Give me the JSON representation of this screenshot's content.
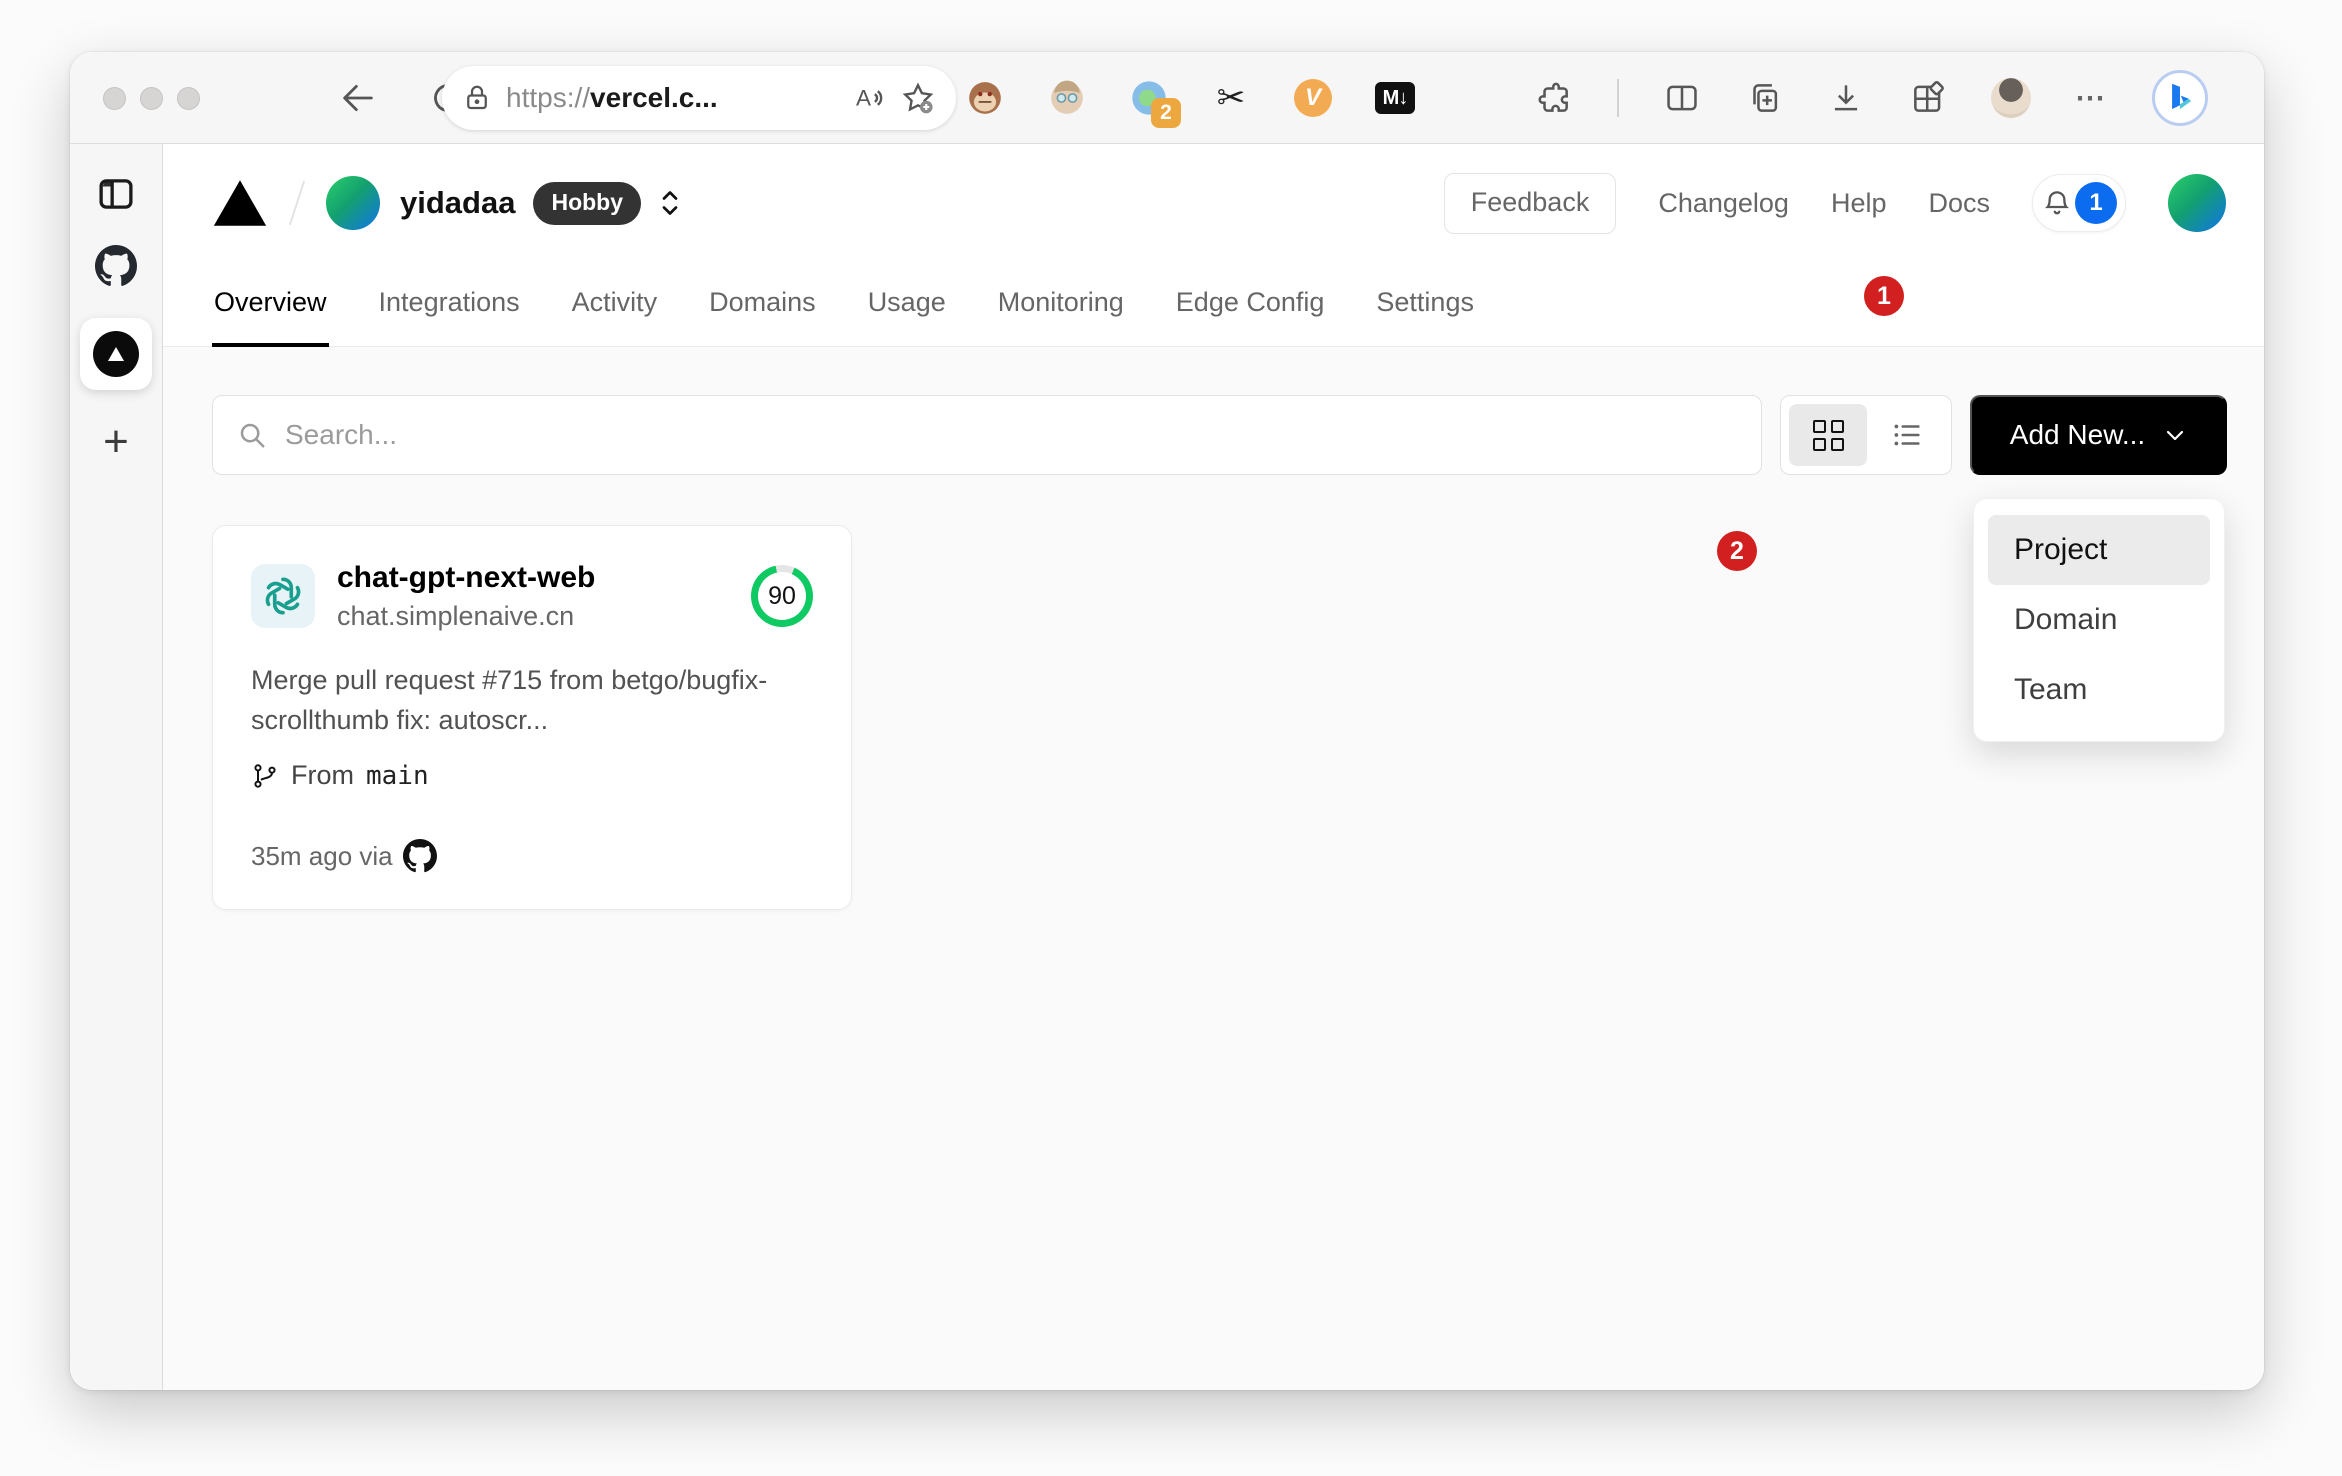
{
  "browser": {
    "url": {
      "scheme": "https://",
      "host": "vercel.c..."
    },
    "extension_badge_count": "2",
    "markdown_ext_label": "M↓",
    "v_ext_label": "V",
    "more_label": "⋯"
  },
  "vercel": {
    "header": {
      "team_name": "yidadaa",
      "plan_badge": "Hobby",
      "feedback_label": "Feedback",
      "links": [
        {
          "label": "Changelog"
        },
        {
          "label": "Help"
        },
        {
          "label": "Docs"
        }
      ],
      "notification_count": "1"
    },
    "tabs": [
      {
        "label": "Overview",
        "active": true
      },
      {
        "label": "Integrations"
      },
      {
        "label": "Activity"
      },
      {
        "label": "Domains"
      },
      {
        "label": "Usage"
      },
      {
        "label": "Monitoring"
      },
      {
        "label": "Edge Config"
      },
      {
        "label": "Settings"
      }
    ],
    "controls": {
      "search_placeholder": "Search...",
      "add_new_label": "Add New..."
    },
    "project_card": {
      "name": "chat-gpt-next-web",
      "domain": "chat.simplenaive.cn",
      "score": "90",
      "description": "Merge pull request #715 from betgo/bugfix-scrollthumb fix: autoscr...",
      "branch_prefix": "From",
      "branch_name": "main",
      "deployed_label": "35m ago via"
    },
    "dropdown": {
      "items": [
        {
          "label": "Project",
          "selected": true
        },
        {
          "label": "Domain"
        },
        {
          "label": "Team"
        }
      ]
    }
  },
  "annotations": {
    "step1": "1",
    "step2": "2"
  },
  "colors": {
    "annotation_red": "#d21f1f",
    "score_green": "#0fc963",
    "notification_blue": "#0b6cf0",
    "avatar_gradient_start": "#2bd06a",
    "avatar_gradient_end": "#1273ea",
    "add_new_black": "#000000",
    "openai_teal": "#1a9f8f"
  }
}
